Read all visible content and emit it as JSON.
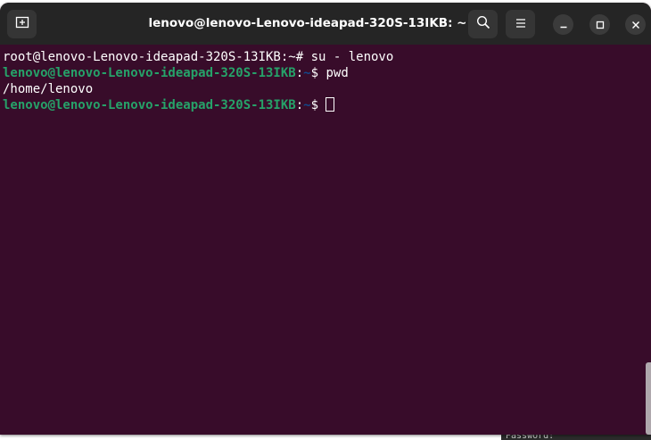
{
  "window": {
    "title": "lenovo@lenovo-Lenovo-ideapad-320S-13IKB: ~"
  },
  "titlebar": {
    "new_tab_icon": "new-tab-icon",
    "search_icon": "search-icon",
    "menu_icon": "hamburger-menu-icon",
    "minimize_icon": "minimize-icon",
    "maximize_icon": "maximize-icon",
    "close_icon": "close-icon"
  },
  "terminal": {
    "line1_prompt": "root@lenovo-Lenovo-ideapad-320S-13IKB:~# ",
    "line1_cmd": "su - lenovo",
    "line2_user": "lenovo@lenovo-Lenovo-ideapad-320S-13IKB",
    "line2_colon": ":",
    "line2_path": "~",
    "line2_dollar": "$ ",
    "line2_cmd": "pwd",
    "line3_output": "/home/lenovo",
    "line4_user": "lenovo@lenovo-Lenovo-ideapad-320S-13IKB",
    "line4_colon": ":",
    "line4_path": "~",
    "line4_dollar": "$ "
  },
  "background_window": {
    "text": "Password:"
  },
  "colors": {
    "terminal_bg": "#380c2a",
    "titlebar_bg": "#252525",
    "user_host": "#26a269",
    "path": "#12488b"
  }
}
